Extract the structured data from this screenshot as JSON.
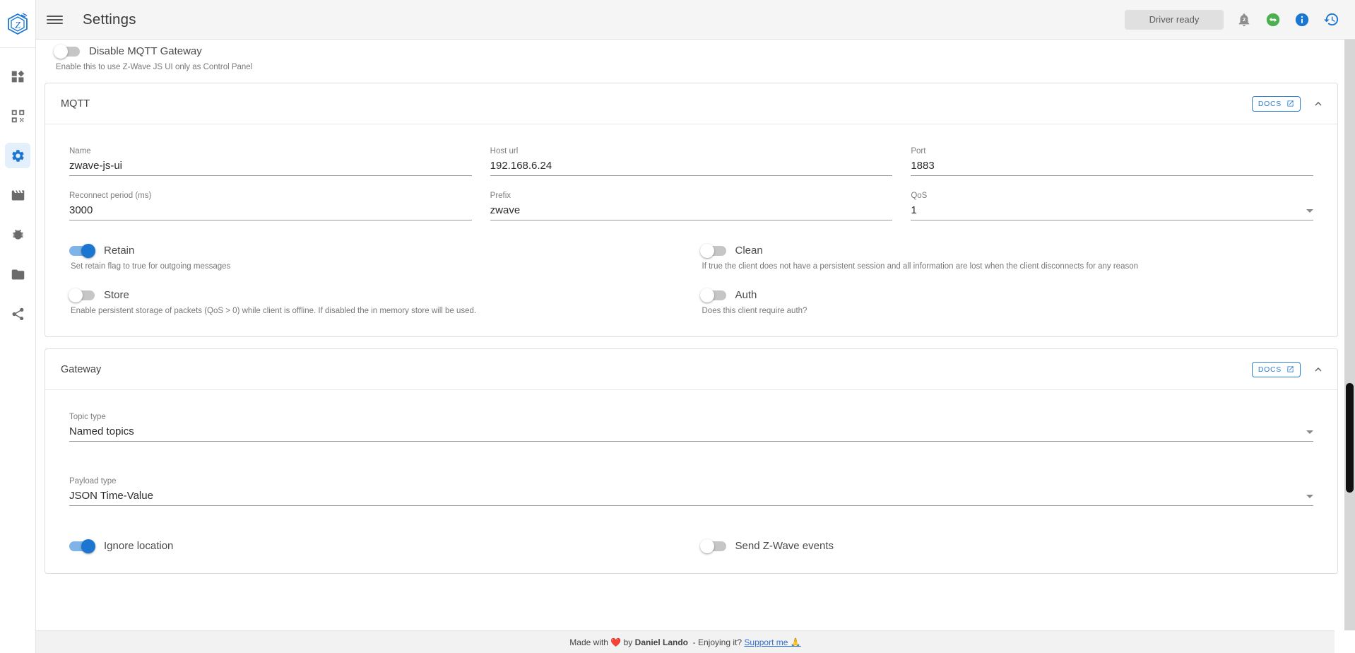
{
  "app": {
    "title": "Settings",
    "logo_icon": "zwave-logo-icon",
    "menu_icon": "hamburger-menu-icon"
  },
  "sidebar": {
    "items": [
      {
        "name": "dashboard",
        "icon": "dashboard-widgets-icon",
        "active": false
      },
      {
        "name": "control-panel",
        "icon": "mesh-nodes-icon",
        "active": false
      },
      {
        "name": "settings",
        "icon": "gear-icon",
        "active": true
      },
      {
        "name": "scenes",
        "icon": "movie-clapper-icon",
        "active": false
      },
      {
        "name": "debug",
        "icon": "bug-icon",
        "active": false
      },
      {
        "name": "store",
        "icon": "folder-icon",
        "active": false
      },
      {
        "name": "network-graph",
        "icon": "share-nodes-icon",
        "active": false
      }
    ]
  },
  "header": {
    "driver_status": "Driver ready",
    "notifications_count": "2",
    "icons": {
      "notifications": "bell-icon",
      "connection": "swap-horizontal-circle-icon",
      "info": "info-circle-icon",
      "history": "restore-history-icon"
    }
  },
  "top_setting": {
    "label": "Disable MQTT Gateway",
    "hint": "Enable this to use Z-Wave JS UI only as Control Panel",
    "enabled": false
  },
  "cards": [
    {
      "title": "MQTT",
      "docs_label": "DOCS",
      "docs_icon": "external-link-icon",
      "collapse_icon": "chevron-up-icon",
      "fields_row1": [
        {
          "label": "Name",
          "value": "zwave-js-ui",
          "type": "text"
        },
        {
          "label": "Host url",
          "value": "192.168.6.24",
          "type": "text"
        },
        {
          "label": "Port",
          "value": "1883",
          "type": "text"
        }
      ],
      "fields_row2": [
        {
          "label": "Reconnect period (ms)",
          "value": "3000",
          "type": "text"
        },
        {
          "label": "Prefix",
          "value": "zwave",
          "type": "text"
        },
        {
          "label": "QoS",
          "value": "1",
          "type": "select"
        }
      ],
      "switches": [
        {
          "label": "Retain",
          "hint": "Set retain flag to true for outgoing messages",
          "enabled": true
        },
        {
          "label": "Clean",
          "hint": "If true the client does not have a persistent session and all information are lost when the client disconnects for any reason",
          "enabled": false
        },
        {
          "label": "Store",
          "hint": "Enable persistent storage of packets (QoS > 0) while client is offline. If disabled the in memory store will be used.",
          "enabled": false
        },
        {
          "label": "Auth",
          "hint": "Does this client require auth?",
          "enabled": false
        }
      ]
    },
    {
      "title": "Gateway",
      "docs_label": "DOCS",
      "docs_icon": "external-link-icon",
      "collapse_icon": "chevron-up-icon",
      "selects": [
        {
          "label": "Topic type",
          "value": "Named topics"
        },
        {
          "label": "Payload type",
          "value": "JSON Time-Value"
        }
      ],
      "switches": [
        {
          "label": "Ignore location",
          "enabled": true
        },
        {
          "label": "Send Z-Wave events",
          "enabled": false
        }
      ]
    }
  ],
  "footer": {
    "made_with": "Made with",
    "heart": "❤️",
    "by": "by",
    "author": "Daniel Lando",
    "enjoying": "- Enjoying it?",
    "support_link": "Support me 🙏"
  },
  "colors": {
    "accent": "#1b76d2",
    "docs_border": "#2f7fd1",
    "connection_ok": "#4caf50",
    "info": "#1b76d2"
  }
}
